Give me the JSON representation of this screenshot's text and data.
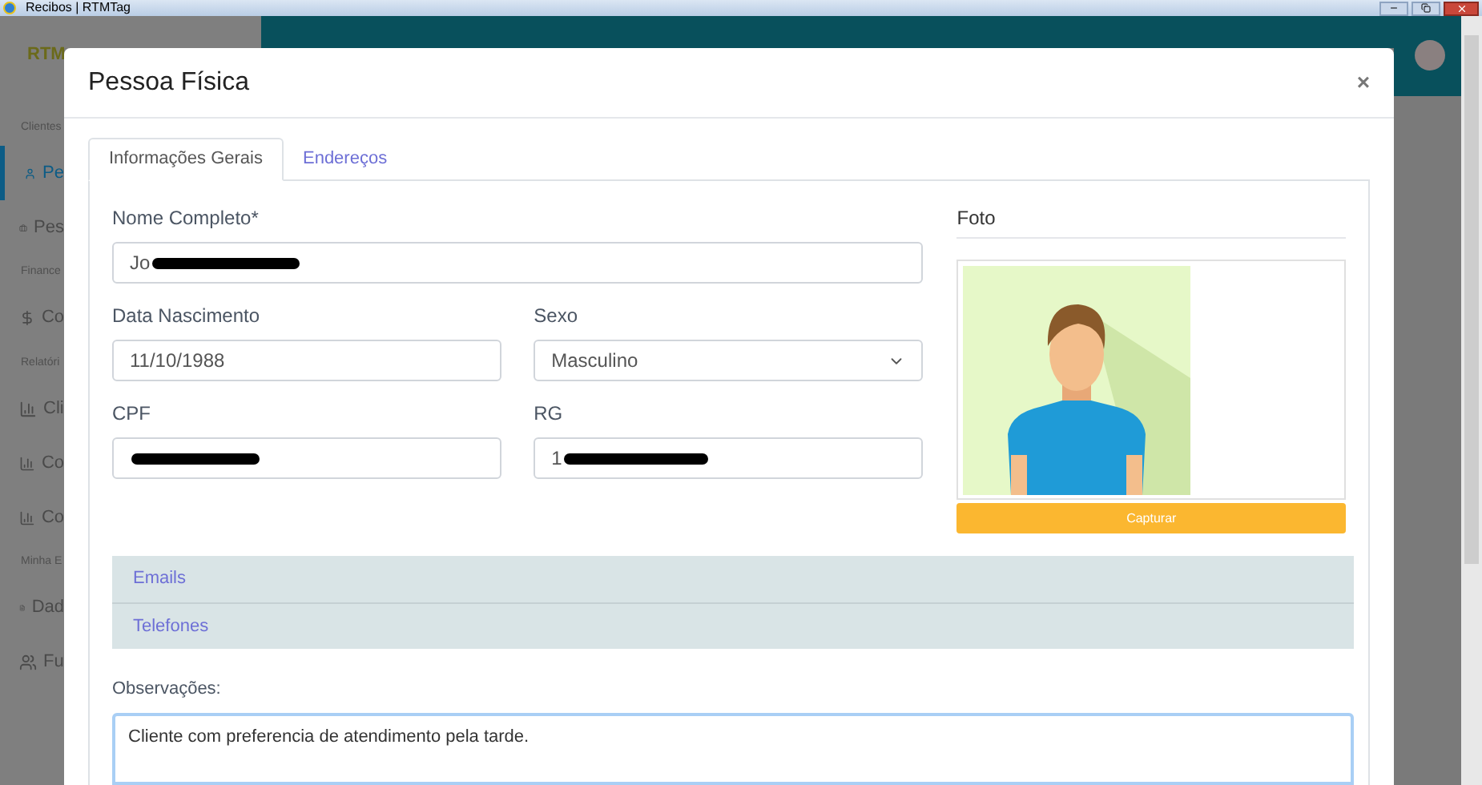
{
  "window": {
    "title": "Recibos | RTMTag"
  },
  "sidebar": {
    "logo": "RTM",
    "items": [
      {
        "kind": "section",
        "label": "Clientes"
      },
      {
        "kind": "person",
        "label": "Pe",
        "selected": true
      },
      {
        "kind": "case",
        "label": "Pes",
        "selected": false
      },
      {
        "kind": "section",
        "label": "Finance"
      },
      {
        "kind": "money",
        "label": "Co",
        "selected": false
      },
      {
        "kind": "section",
        "label": "Relatóri"
      },
      {
        "kind": "report",
        "label": "Cli",
        "selected": false
      },
      {
        "kind": "report",
        "label": "Co",
        "selected": false
      },
      {
        "kind": "report",
        "label": "Co",
        "selected": false
      },
      {
        "kind": "section",
        "label": "Minha E"
      },
      {
        "kind": "doc",
        "label": "Dad",
        "selected": false
      },
      {
        "kind": "team",
        "label": "Fu",
        "selected": false
      }
    ]
  },
  "modal": {
    "title": "Pessoa Física",
    "close": "×",
    "tabs": [
      {
        "label": "Informações Gerais",
        "selected": true
      },
      {
        "label": "Endereços",
        "selected": false
      }
    ],
    "fields": {
      "nome": {
        "label": "Nome Completo*",
        "value": "Jo",
        "redacted": true
      },
      "data": {
        "label": "Data Nascimento",
        "value": "11/10/1988"
      },
      "sexo": {
        "label": "Sexo",
        "value": "Masculino"
      },
      "cpf": {
        "label": "CPF",
        "redacted": true
      },
      "rg": {
        "label": "RG",
        "value": "1",
        "redacted": true
      }
    },
    "photo": {
      "title": "Foto",
      "button": "Capturar"
    },
    "sections": [
      {
        "label": "Emails"
      },
      {
        "label": "Telefones"
      }
    ],
    "notes": {
      "label": "Observações:",
      "value": "Cliente com preferencia de atendimento pela tarde."
    }
  }
}
